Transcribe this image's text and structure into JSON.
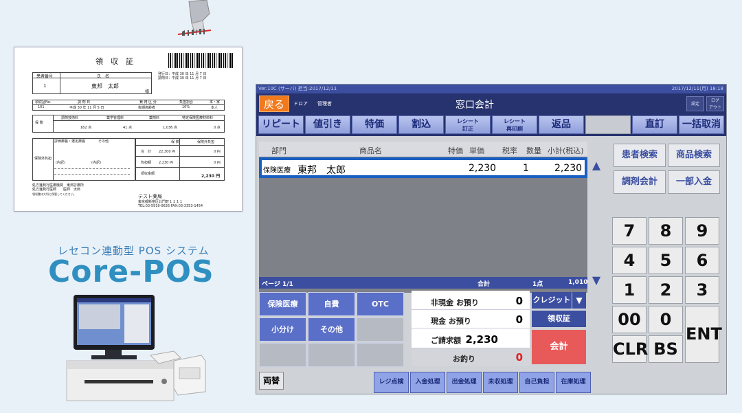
{
  "receipt": {
    "title": "領　収　証",
    "patient_no_label": "患者番号",
    "name_label": "氏　名",
    "patient_no": "1",
    "patient_name": "東邦　太郎",
    "sama": "様",
    "issue_text": "発行日：平成 30 年 11 月 7 日",
    "sales_text": "調剤日：平成 30 年 11 月 7 日",
    "h1": "領収証No.",
    "h2": "調 剤 日",
    "h3": "費 用 区 分",
    "h4": "負担割合",
    "h5": "本・家",
    "r1": "101",
    "r2": "平成 30 年 11 月 5 日",
    "r3": "後期高齢者",
    "r4": "10%",
    "r5": "本人",
    "ins_label": "保 険",
    "c1": "調剤技術料",
    "c2": "薬学管理料",
    "c3": "薬剤料",
    "c4": "特定保険医療材料料",
    "v1": "162 点",
    "v2": "41 点",
    "v3": "1,036 点",
    "v4": "0 点",
    "misc_hdr": "評価療養・選定療養",
    "misc_hdr2": "その他",
    "misc_label": "保険外負担",
    "misc_in": "(内訳)",
    "misc_in2": "(内訳)",
    "tot_hdr": "保 険",
    "tot_hdr2": "保険外負担",
    "tot1_l": "合　計",
    "tot1_a": "22,300 円",
    "tot1_b": "0 円",
    "tot2_l": "負担額",
    "tot2_a": "2,230 円",
    "tot2_b": "0 円",
    "tot3_l": "領収金額",
    "tot3_b": "2,230 円",
    "foot1": "処方箋発行医療機関　東邦診療所",
    "foot2": "処方箋発行医師　　医師　太郎",
    "foot3": "領収書は大切に保管してください。",
    "pharmacy": "テスト薬局",
    "addr1": "東京都新宿区北門町１１１１",
    "addr2": "TEL:03-5919-0626 FAX:03-3353-1454"
  },
  "brand": {
    "tagline": "レセコン連動型 POS システム",
    "name": "Core-POS"
  },
  "pos": {
    "titlebar_left": "Ver.10C (サーバ) 担当:2017/12/11",
    "titlebar_right": "2017/12/11(月) 18:18",
    "back": "戻る",
    "user_tag": "ドロア　　管理者",
    "title": "窓口会計",
    "hbtn1": "設定",
    "hbtn2": "ログ\nアウト",
    "toolbar": [
      "リピート",
      "値引き",
      "特価",
      "割込",
      "レシート\n訂正",
      "レシート\n再印刷",
      "返品",
      "",
      "直訂",
      "一括取消"
    ],
    "columns": {
      "dept": "部門",
      "item": "商品名",
      "special": "特価",
      "price": "単価",
      "tax": "税率",
      "qty": "数量",
      "subtotal": "小計(税込)"
    },
    "rows": [
      {
        "dept": "保険医療",
        "item": "東邦　太郎",
        "price": "2,230",
        "qty": "1",
        "subtotal": "2,230"
      }
    ],
    "page": "ページ 1/1",
    "total_label": "合計",
    "count": "1点",
    "total": "1,010",
    "categories": [
      "保険医療",
      "自費",
      "OTC",
      "小分け",
      "その他"
    ],
    "amounts": [
      {
        "label": "非現金 お預り",
        "value": "0"
      },
      {
        "label": "現金 お預り",
        "value": "0"
      },
      {
        "label": "ご請求額",
        "value": "2,230"
      },
      {
        "label": "お釣り",
        "value": "0"
      }
    ],
    "credit": "クレジット",
    "receipt_btn": "領収証",
    "checkout": "会計",
    "exchange": "両替",
    "footer": [
      "レジ点検",
      "入金処理",
      "出金処理",
      "未収処理",
      "自己負担",
      "在庫処理"
    ],
    "search": [
      "患者検索",
      "商品検索",
      "調剤会計",
      "一部入金"
    ],
    "keys": [
      "7",
      "8",
      "9",
      "4",
      "5",
      "6",
      "1",
      "2",
      "3",
      "00",
      "0",
      "ENT",
      "CLR",
      "BS"
    ]
  }
}
